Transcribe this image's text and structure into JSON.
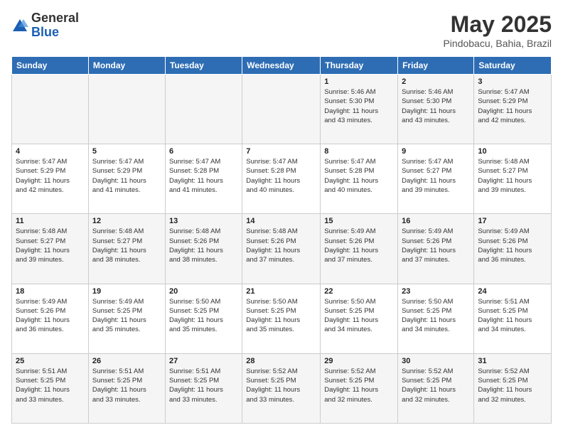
{
  "logo": {
    "general": "General",
    "blue": "Blue"
  },
  "header": {
    "month": "May 2025",
    "location": "Pindobacu, Bahia, Brazil"
  },
  "weekdays": [
    "Sunday",
    "Monday",
    "Tuesday",
    "Wednesday",
    "Thursday",
    "Friday",
    "Saturday"
  ],
  "weeks": [
    [
      {
        "num": "",
        "detail": ""
      },
      {
        "num": "",
        "detail": ""
      },
      {
        "num": "",
        "detail": ""
      },
      {
        "num": "",
        "detail": ""
      },
      {
        "num": "1",
        "detail": "Sunrise: 5:46 AM\nSunset: 5:30 PM\nDaylight: 11 hours\nand 43 minutes."
      },
      {
        "num": "2",
        "detail": "Sunrise: 5:46 AM\nSunset: 5:30 PM\nDaylight: 11 hours\nand 43 minutes."
      },
      {
        "num": "3",
        "detail": "Sunrise: 5:47 AM\nSunset: 5:29 PM\nDaylight: 11 hours\nand 42 minutes."
      }
    ],
    [
      {
        "num": "4",
        "detail": "Sunrise: 5:47 AM\nSunset: 5:29 PM\nDaylight: 11 hours\nand 42 minutes."
      },
      {
        "num": "5",
        "detail": "Sunrise: 5:47 AM\nSunset: 5:29 PM\nDaylight: 11 hours\nand 41 minutes."
      },
      {
        "num": "6",
        "detail": "Sunrise: 5:47 AM\nSunset: 5:28 PM\nDaylight: 11 hours\nand 41 minutes."
      },
      {
        "num": "7",
        "detail": "Sunrise: 5:47 AM\nSunset: 5:28 PM\nDaylight: 11 hours\nand 40 minutes."
      },
      {
        "num": "8",
        "detail": "Sunrise: 5:47 AM\nSunset: 5:28 PM\nDaylight: 11 hours\nand 40 minutes."
      },
      {
        "num": "9",
        "detail": "Sunrise: 5:47 AM\nSunset: 5:27 PM\nDaylight: 11 hours\nand 39 minutes."
      },
      {
        "num": "10",
        "detail": "Sunrise: 5:48 AM\nSunset: 5:27 PM\nDaylight: 11 hours\nand 39 minutes."
      }
    ],
    [
      {
        "num": "11",
        "detail": "Sunrise: 5:48 AM\nSunset: 5:27 PM\nDaylight: 11 hours\nand 39 minutes."
      },
      {
        "num": "12",
        "detail": "Sunrise: 5:48 AM\nSunset: 5:27 PM\nDaylight: 11 hours\nand 38 minutes."
      },
      {
        "num": "13",
        "detail": "Sunrise: 5:48 AM\nSunset: 5:26 PM\nDaylight: 11 hours\nand 38 minutes."
      },
      {
        "num": "14",
        "detail": "Sunrise: 5:48 AM\nSunset: 5:26 PM\nDaylight: 11 hours\nand 37 minutes."
      },
      {
        "num": "15",
        "detail": "Sunrise: 5:49 AM\nSunset: 5:26 PM\nDaylight: 11 hours\nand 37 minutes."
      },
      {
        "num": "16",
        "detail": "Sunrise: 5:49 AM\nSunset: 5:26 PM\nDaylight: 11 hours\nand 37 minutes."
      },
      {
        "num": "17",
        "detail": "Sunrise: 5:49 AM\nSunset: 5:26 PM\nDaylight: 11 hours\nand 36 minutes."
      }
    ],
    [
      {
        "num": "18",
        "detail": "Sunrise: 5:49 AM\nSunset: 5:26 PM\nDaylight: 11 hours\nand 36 minutes."
      },
      {
        "num": "19",
        "detail": "Sunrise: 5:49 AM\nSunset: 5:25 PM\nDaylight: 11 hours\nand 35 minutes."
      },
      {
        "num": "20",
        "detail": "Sunrise: 5:50 AM\nSunset: 5:25 PM\nDaylight: 11 hours\nand 35 minutes."
      },
      {
        "num": "21",
        "detail": "Sunrise: 5:50 AM\nSunset: 5:25 PM\nDaylight: 11 hours\nand 35 minutes."
      },
      {
        "num": "22",
        "detail": "Sunrise: 5:50 AM\nSunset: 5:25 PM\nDaylight: 11 hours\nand 34 minutes."
      },
      {
        "num": "23",
        "detail": "Sunrise: 5:50 AM\nSunset: 5:25 PM\nDaylight: 11 hours\nand 34 minutes."
      },
      {
        "num": "24",
        "detail": "Sunrise: 5:51 AM\nSunset: 5:25 PM\nDaylight: 11 hours\nand 34 minutes."
      }
    ],
    [
      {
        "num": "25",
        "detail": "Sunrise: 5:51 AM\nSunset: 5:25 PM\nDaylight: 11 hours\nand 33 minutes."
      },
      {
        "num": "26",
        "detail": "Sunrise: 5:51 AM\nSunset: 5:25 PM\nDaylight: 11 hours\nand 33 minutes."
      },
      {
        "num": "27",
        "detail": "Sunrise: 5:51 AM\nSunset: 5:25 PM\nDaylight: 11 hours\nand 33 minutes."
      },
      {
        "num": "28",
        "detail": "Sunrise: 5:52 AM\nSunset: 5:25 PM\nDaylight: 11 hours\nand 33 minutes."
      },
      {
        "num": "29",
        "detail": "Sunrise: 5:52 AM\nSunset: 5:25 PM\nDaylight: 11 hours\nand 32 minutes."
      },
      {
        "num": "30",
        "detail": "Sunrise: 5:52 AM\nSunset: 5:25 PM\nDaylight: 11 hours\nand 32 minutes."
      },
      {
        "num": "31",
        "detail": "Sunrise: 5:52 AM\nSunset: 5:25 PM\nDaylight: 11 hours\nand 32 minutes."
      }
    ]
  ]
}
